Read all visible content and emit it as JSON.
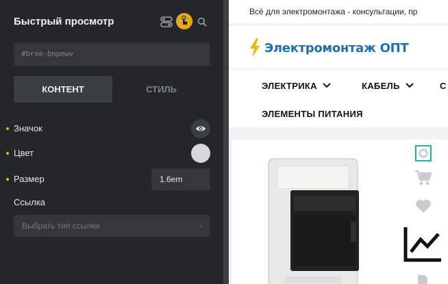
{
  "panel": {
    "title": "Быстрый просмотр",
    "element_id": "#brxe-bnpewv",
    "tabs": [
      {
        "label": "КОНТЕНТ",
        "active": true
      },
      {
        "label": "СТИЛЬ",
        "active": false
      }
    ],
    "fields": {
      "icon_label": "Значок",
      "icon_name": "eye-icon",
      "color_label": "Цвет",
      "color_value": "#d6d7d9",
      "size_label": "Размер",
      "size_value": "1.6em",
      "link_label": "Ссылка",
      "link_placeholder": "Выбрать тип ссылки"
    }
  },
  "site": {
    "top_text": "Всё для электромонтажа - консультации, пр",
    "logo": "Электромонтаж ОПТ",
    "nav": [
      {
        "label": "ЭЛЕКТРИКА"
      },
      {
        "label": "КАБЕЛЬ"
      },
      {
        "label": "С"
      },
      {
        "label": "ЭЛЕМЕНТЫ ПИТАНИЯ"
      }
    ]
  },
  "colors": {
    "accent": "#f0b400",
    "panel_bg": "#23262b",
    "brand_blue": "#1e6fb5"
  }
}
